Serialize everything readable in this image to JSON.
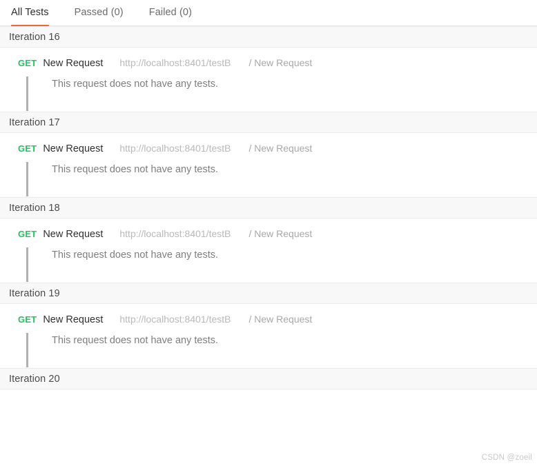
{
  "tabs": [
    {
      "label": "All Tests",
      "active": true
    },
    {
      "label": "Passed (0)",
      "active": false
    },
    {
      "label": "Failed (0)",
      "active": false
    }
  ],
  "colors": {
    "accent": "#f2643c",
    "method_get": "#23c45e",
    "header_band": "#f8f8f8",
    "muted_text": "#7e7e7e",
    "url_text": "#b9b9b9"
  },
  "iterations": [
    {
      "title": "Iteration 16",
      "request": {
        "method": "GET",
        "name": "New Request",
        "url": "http://localhost:8401/testB",
        "path": "/ New Request",
        "message": "This request does not have any tests."
      }
    },
    {
      "title": "Iteration 17",
      "request": {
        "method": "GET",
        "name": "New Request",
        "url": "http://localhost:8401/testB",
        "path": "/ New Request",
        "message": "This request does not have any tests."
      }
    },
    {
      "title": "Iteration 18",
      "request": {
        "method": "GET",
        "name": "New Request",
        "url": "http://localhost:8401/testB",
        "path": "/ New Request",
        "message": "This request does not have any tests."
      }
    },
    {
      "title": "Iteration 19",
      "request": {
        "method": "GET",
        "name": "New Request",
        "url": "http://localhost:8401/testB",
        "path": "/ New Request",
        "message": "This request does not have any tests."
      }
    },
    {
      "title": "Iteration 20",
      "request": null
    }
  ],
  "watermark": "CSDN @zoeil"
}
